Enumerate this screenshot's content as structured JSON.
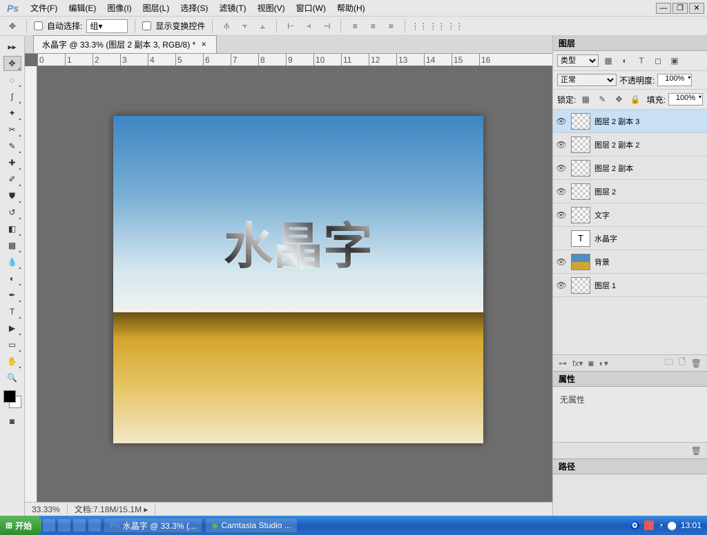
{
  "menu": {
    "file": "文件(F)",
    "edit": "编辑(E)",
    "image": "图像(I)",
    "layer": "图层(L)",
    "select": "选择(S)",
    "filter": "滤镜(T)",
    "view": "视图(V)",
    "window": "窗口(W)",
    "help": "帮助(H)"
  },
  "options": {
    "auto_select": "自动选择:",
    "group": "组",
    "show_transform": "显示变换控件"
  },
  "document": {
    "tab_title": "水晶字 @ 33.3% (图层 2 副本 3, RGB/8) *",
    "canvas_text": "水晶字",
    "zoom": "33.33%",
    "doc_label": "文档:",
    "doc_size": "7.18M/15.1M"
  },
  "ruler_marks": [
    "0",
    "1",
    "2",
    "3",
    "4",
    "5",
    "6",
    "7",
    "8",
    "9",
    "10",
    "11",
    "12",
    "13",
    "14",
    "15",
    "16"
  ],
  "layers_panel": {
    "title": "图层",
    "type_label": "类型",
    "blend_mode": "正常",
    "opacity_label": "不透明度:",
    "opacity_value": "100%",
    "lock_label": "锁定:",
    "fill_label": "填充:",
    "fill_value": "100%",
    "layers": [
      {
        "name": "图层 2 副本 3",
        "visible": true,
        "selected": true,
        "type": "raster"
      },
      {
        "name": "图层 2 副本 2",
        "visible": true,
        "selected": false,
        "type": "raster"
      },
      {
        "name": "图层 2 副本",
        "visible": true,
        "selected": false,
        "type": "raster"
      },
      {
        "name": "图层 2",
        "visible": true,
        "selected": false,
        "type": "raster"
      },
      {
        "name": "文字",
        "visible": true,
        "selected": false,
        "type": "raster"
      },
      {
        "name": "水晶字",
        "visible": false,
        "selected": false,
        "type": "text"
      },
      {
        "name": "背景",
        "visible": true,
        "selected": false,
        "type": "gradient"
      },
      {
        "name": "图层 1",
        "visible": true,
        "selected": false,
        "type": "raster"
      }
    ]
  },
  "properties_panel": {
    "title": "属性",
    "content": "无属性"
  },
  "paths_panel": {
    "title": "路径"
  },
  "taskbar": {
    "start": "开始",
    "task1": "水晶字 @ 33.3% (...",
    "task2": "Camtasia Studio ...",
    "clock": "13:01"
  }
}
